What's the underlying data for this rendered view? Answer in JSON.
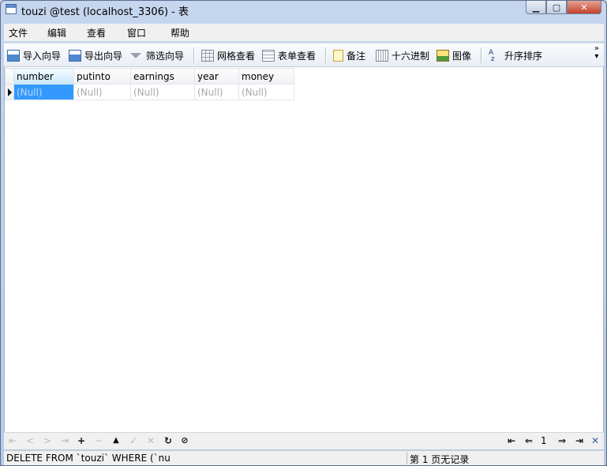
{
  "window": {
    "title": "touzi @test (localhost_3306) - 表"
  },
  "menu": [
    "文件",
    "编辑",
    "查看",
    "窗口",
    "帮助"
  ],
  "toolbar": {
    "import": "导入向导",
    "export": "导出向导",
    "filter": "筛选向导",
    "grid_view": "网格查看",
    "form_view": "表单查看",
    "memo": "备注",
    "hex": "十六进制",
    "image": "图像",
    "sort": "升序排序"
  },
  "grid": {
    "columns": [
      "number",
      "putinto",
      "earnings",
      "year",
      "money"
    ],
    "rows": [
      [
        "(Null)",
        "(Null)",
        "(Null)",
        "(Null)",
        "(Null)"
      ]
    ]
  },
  "nav": {
    "page": "1"
  },
  "status": {
    "sql": "DELETE FROM `touzi` WHERE (`nu",
    "page_info": "第 1 页无记录"
  }
}
